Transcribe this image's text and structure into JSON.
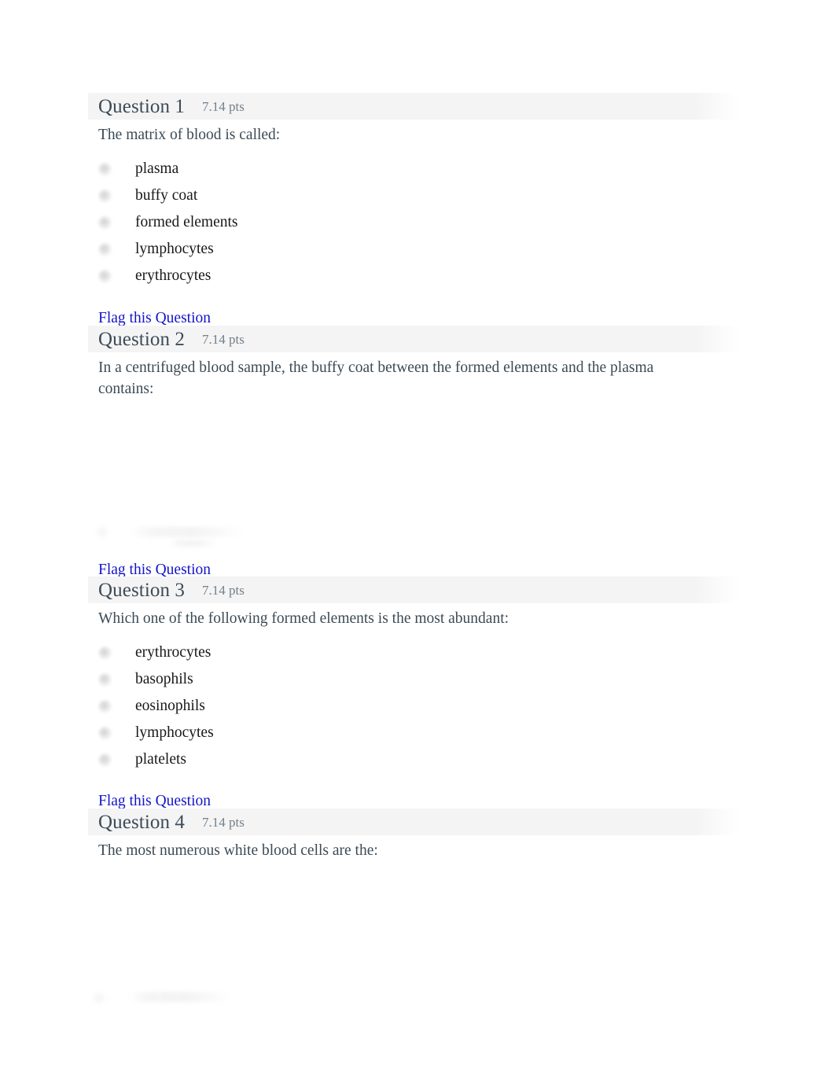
{
  "page": {
    "link_color": "#1414c8",
    "header_band_color": "#f4f4f5",
    "title_color": "#3d4c57",
    "points_color": "#73808a",
    "body_text_color": "#3b4a55"
  },
  "flag_label": "Flag this Question",
  "questions": [
    {
      "name": "Question 1",
      "points": "7.14 pts",
      "text": "The matrix of blood is called:",
      "answers": [
        "plasma",
        "buffy coat",
        "formed elements",
        "lymphocytes",
        "erythrocytes"
      ]
    },
    {
      "name": "Question 2",
      "points": "7.14 pts",
      "text": "In a centrifuged blood sample, the buffy coat between the formed elements and the plasma contains:",
      "answers": []
    },
    {
      "name": "Question 3",
      "points": "7.14 pts",
      "text": "Which one of the following formed elements is the most abundant:",
      "answers": [
        "erythrocytes",
        "basophils",
        "eosinophils",
        "lymphocytes",
        "platelets"
      ]
    },
    {
      "name": "Question 4",
      "points": "7.14 pts",
      "text": "The most numerous white blood cells are the:",
      "answers": []
    }
  ]
}
